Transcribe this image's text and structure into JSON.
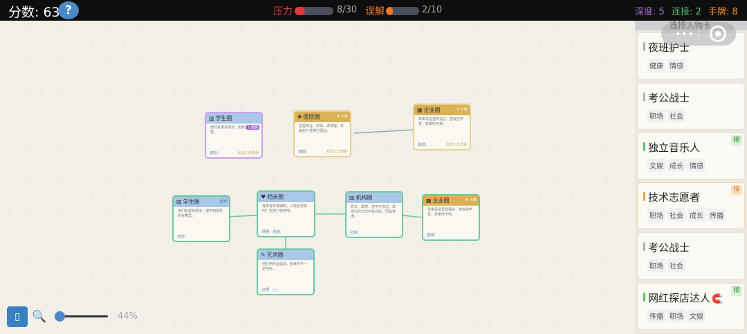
{
  "topbar": {
    "score": "分数: 63",
    "help": "?",
    "pressure_label": "压力",
    "pressure_value": "8/30",
    "pressure_fraction": 0.2667,
    "misunderstand_label": "误解",
    "misunderstand_value": "2/10",
    "misunderstand_fraction": 0.2,
    "depth": "深度: 5",
    "connect": "连接: 2",
    "hand": "手牌: 8"
  },
  "colors": {
    "pressure": "#e23a3a",
    "misunderstand": "#f07a2a",
    "depth": "#b071e0",
    "connect": "#55c06a",
    "hand": "#f0902a",
    "link_green": "#6cc9a0",
    "enterprise_gold": "#d8b254"
  },
  "cards": [
    {
      "title": "学生圈",
      "icon": "book-icon",
      "desc": "他们有很多想法，但机会在哪里。",
      "tags": [
        "成长"
      ],
      "badge": "1 重要",
      "footer": "延迟1 凸角色"
    },
    {
      "title": "医院圈",
      "tagr": "★ 人脉",
      "icon": "hospital-icon",
      "desc": "这里专业、忙碌、讲流程，外面的人觉得它很远。",
      "tags": [
        "健康"
      ],
      "footer": "延迟2 凸角色"
    },
    {
      "title": "企业圈",
      "tagr": "★ 人脉",
      "icon": "building-icon",
      "desc": "效率是这里的语言，但有些声音，效率听不到。",
      "tags": [
        "职场"
      ],
      "footer": "延迟2 凸角色"
    },
    {
      "title": "学生圈",
      "tagr": "起点",
      "icon": "book-icon",
      "desc": "他们有很多想法，但不知道机会在哪里。",
      "tags": [
        "成长"
      ]
    },
    {
      "title": "相亲圈",
      "icon": "heart-icon",
      "desc": "有房有车有编制，三观合得来吗？先加个微信吧。",
      "tags": [
        "情感",
        "社会"
      ]
    },
    {
      "title": "机构圈",
      "icon": "institution-icon",
      "desc": "政文、缓慢、但不可绕过。改变它的方式不是对抗，而是穿透。",
      "tags": [
        "社会"
      ]
    },
    {
      "title": "企业圈",
      "tagr": "★ 人脉",
      "icon": "building-icon",
      "desc": "效率是这里的语言，但有些声音，效率听不到。",
      "tags": [
        "职场"
      ]
    },
    {
      "title": "艺术圈",
      "icon": "palette-icon",
      "desc": "他们用作品说话，但世界不一定在听。",
      "tags": [
        "文娱",
        "···"
      ]
    }
  ],
  "controls": {
    "zoom_btn": "▯",
    "zoom_level": "44%",
    "zoom_fraction": 0.0
  },
  "panel": {
    "title": "选择人物卡",
    "people": [
      {
        "name": "夜班护士",
        "tags": [
          "健康",
          "情感"
        ],
        "bar": "#b0b0b0"
      },
      {
        "name": "考公战士",
        "tags": [
          "职场",
          "社会"
        ],
        "bar": "#b0b0b0"
      },
      {
        "name": "独立音乐人",
        "tags": [
          "文娱",
          "成长",
          "情感"
        ],
        "bar": "#5cbf5c",
        "rarity": "稀",
        "rarity_bg": "#d9f1d4",
        "rarity_fg": "#4a9a4a"
      },
      {
        "name": "技术志愿者",
        "tags": [
          "职场",
          "社会",
          "成长",
          "传播"
        ],
        "bar": "#e8a13a",
        "rarity": "传",
        "rarity_bg": "#fbe4c5",
        "rarity_fg": "#c97a20"
      },
      {
        "name": "考公战士",
        "tags": [
          "职场",
          "社会"
        ],
        "bar": "#b0b0b0"
      },
      {
        "name": "网红探店达人",
        "tags": [
          "传播",
          "职场",
          "文娱"
        ],
        "bar": "#5cbf5c",
        "rarity": "稀",
        "rarity_bg": "#d9f1d4",
        "rarity_fg": "#4a9a4a",
        "magnet": "🧲"
      }
    ]
  }
}
